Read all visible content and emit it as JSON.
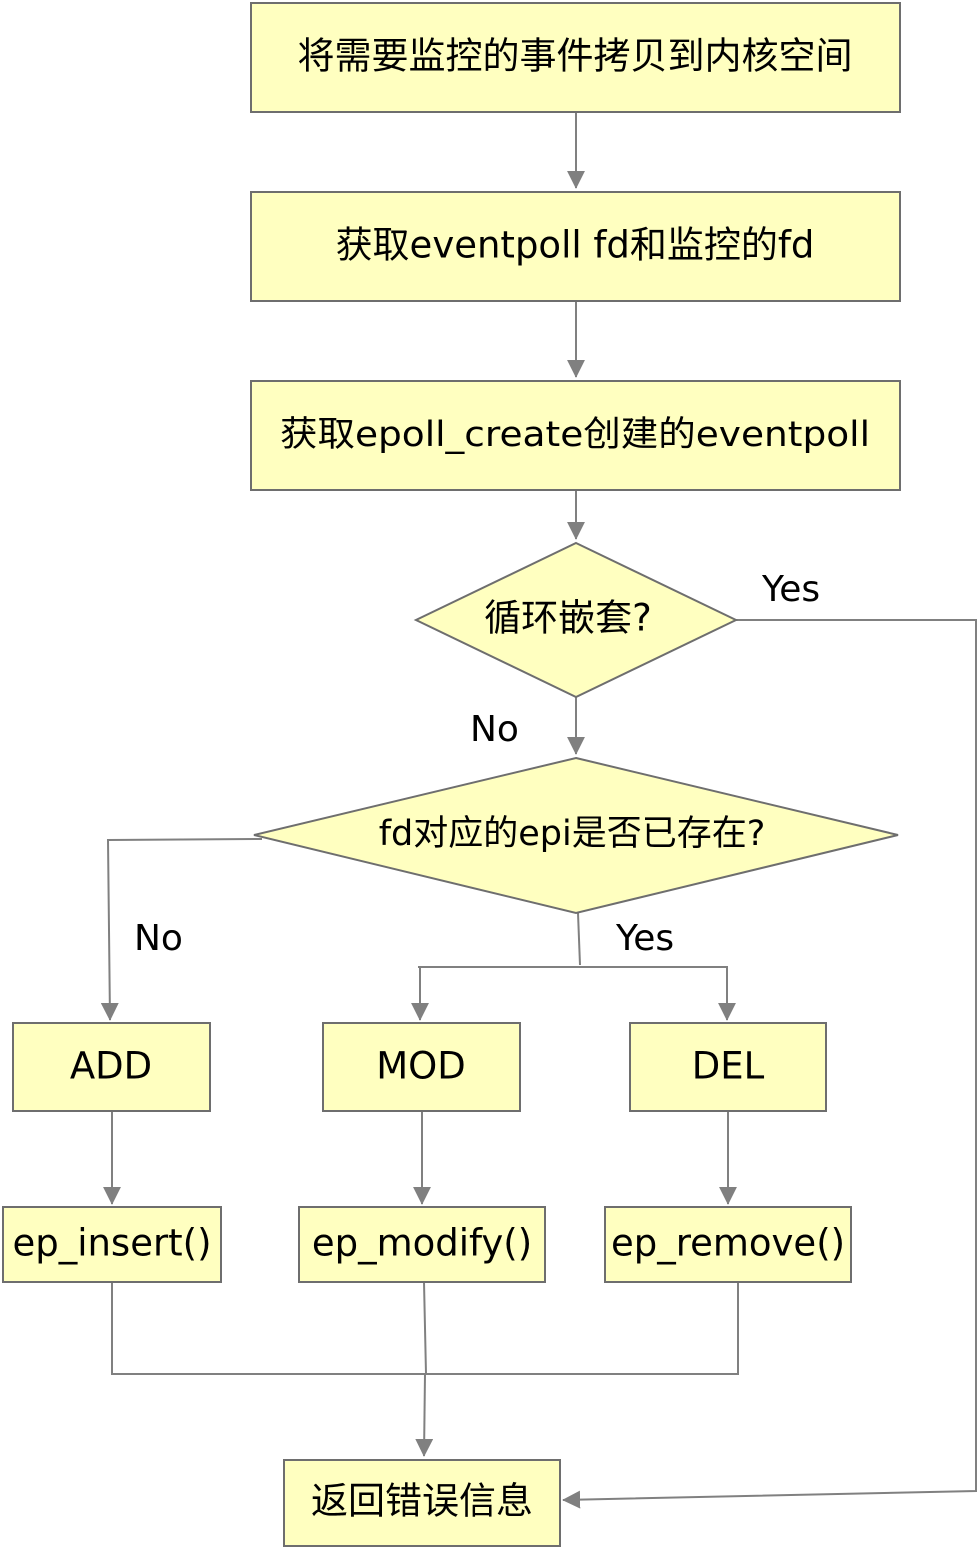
{
  "nodes": {
    "copy_events": "将需要监控的事件拷贝到内核空间",
    "get_fds": "获取eventpoll fd和监控的fd",
    "get_eventpoll": "获取epoll_create创建的eventpoll",
    "loop_check": "循环嵌套?",
    "epi_exists": "fd对应的epi是否已存在?",
    "add": "ADD",
    "mod": "MOD",
    "del": "DEL",
    "ep_insert": "ep_insert()",
    "ep_modify": "ep_modify()",
    "ep_remove": "ep_remove()",
    "return_error": "返回错误信息"
  },
  "edge_labels": {
    "loop_yes": "Yes",
    "loop_no": "No",
    "epi_no": "No",
    "epi_yes": "Yes"
  },
  "colors": {
    "node_fill": "#ffffc0",
    "node_stroke": "#6e6e6e",
    "edge": "#808080"
  }
}
